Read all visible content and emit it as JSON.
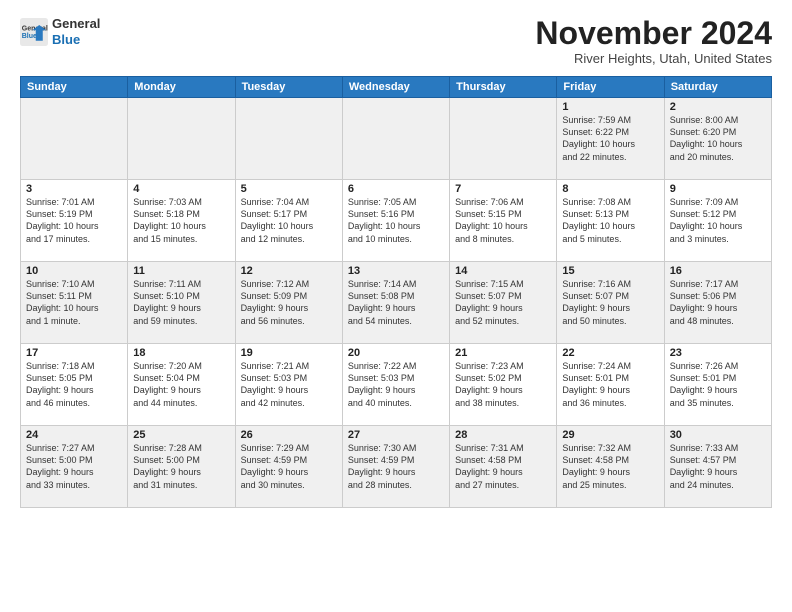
{
  "header": {
    "logo_line1": "General",
    "logo_line2": "Blue",
    "month": "November 2024",
    "location": "River Heights, Utah, United States"
  },
  "days_of_week": [
    "Sunday",
    "Monday",
    "Tuesday",
    "Wednesday",
    "Thursday",
    "Friday",
    "Saturday"
  ],
  "weeks": [
    [
      {
        "day": "",
        "info": ""
      },
      {
        "day": "",
        "info": ""
      },
      {
        "day": "",
        "info": ""
      },
      {
        "day": "",
        "info": ""
      },
      {
        "day": "",
        "info": ""
      },
      {
        "day": "1",
        "info": "Sunrise: 7:59 AM\nSunset: 6:22 PM\nDaylight: 10 hours\nand 22 minutes."
      },
      {
        "day": "2",
        "info": "Sunrise: 8:00 AM\nSunset: 6:20 PM\nDaylight: 10 hours\nand 20 minutes."
      }
    ],
    [
      {
        "day": "3",
        "info": "Sunrise: 7:01 AM\nSunset: 5:19 PM\nDaylight: 10 hours\nand 17 minutes."
      },
      {
        "day": "4",
        "info": "Sunrise: 7:03 AM\nSunset: 5:18 PM\nDaylight: 10 hours\nand 15 minutes."
      },
      {
        "day": "5",
        "info": "Sunrise: 7:04 AM\nSunset: 5:17 PM\nDaylight: 10 hours\nand 12 minutes."
      },
      {
        "day": "6",
        "info": "Sunrise: 7:05 AM\nSunset: 5:16 PM\nDaylight: 10 hours\nand 10 minutes."
      },
      {
        "day": "7",
        "info": "Sunrise: 7:06 AM\nSunset: 5:15 PM\nDaylight: 10 hours\nand 8 minutes."
      },
      {
        "day": "8",
        "info": "Sunrise: 7:08 AM\nSunset: 5:13 PM\nDaylight: 10 hours\nand 5 minutes."
      },
      {
        "day": "9",
        "info": "Sunrise: 7:09 AM\nSunset: 5:12 PM\nDaylight: 10 hours\nand 3 minutes."
      }
    ],
    [
      {
        "day": "10",
        "info": "Sunrise: 7:10 AM\nSunset: 5:11 PM\nDaylight: 10 hours\nand 1 minute."
      },
      {
        "day": "11",
        "info": "Sunrise: 7:11 AM\nSunset: 5:10 PM\nDaylight: 9 hours\nand 59 minutes."
      },
      {
        "day": "12",
        "info": "Sunrise: 7:12 AM\nSunset: 5:09 PM\nDaylight: 9 hours\nand 56 minutes."
      },
      {
        "day": "13",
        "info": "Sunrise: 7:14 AM\nSunset: 5:08 PM\nDaylight: 9 hours\nand 54 minutes."
      },
      {
        "day": "14",
        "info": "Sunrise: 7:15 AM\nSunset: 5:07 PM\nDaylight: 9 hours\nand 52 minutes."
      },
      {
        "day": "15",
        "info": "Sunrise: 7:16 AM\nSunset: 5:07 PM\nDaylight: 9 hours\nand 50 minutes."
      },
      {
        "day": "16",
        "info": "Sunrise: 7:17 AM\nSunset: 5:06 PM\nDaylight: 9 hours\nand 48 minutes."
      }
    ],
    [
      {
        "day": "17",
        "info": "Sunrise: 7:18 AM\nSunset: 5:05 PM\nDaylight: 9 hours\nand 46 minutes."
      },
      {
        "day": "18",
        "info": "Sunrise: 7:20 AM\nSunset: 5:04 PM\nDaylight: 9 hours\nand 44 minutes."
      },
      {
        "day": "19",
        "info": "Sunrise: 7:21 AM\nSunset: 5:03 PM\nDaylight: 9 hours\nand 42 minutes."
      },
      {
        "day": "20",
        "info": "Sunrise: 7:22 AM\nSunset: 5:03 PM\nDaylight: 9 hours\nand 40 minutes."
      },
      {
        "day": "21",
        "info": "Sunrise: 7:23 AM\nSunset: 5:02 PM\nDaylight: 9 hours\nand 38 minutes."
      },
      {
        "day": "22",
        "info": "Sunrise: 7:24 AM\nSunset: 5:01 PM\nDaylight: 9 hours\nand 36 minutes."
      },
      {
        "day": "23",
        "info": "Sunrise: 7:26 AM\nSunset: 5:01 PM\nDaylight: 9 hours\nand 35 minutes."
      }
    ],
    [
      {
        "day": "24",
        "info": "Sunrise: 7:27 AM\nSunset: 5:00 PM\nDaylight: 9 hours\nand 33 minutes."
      },
      {
        "day": "25",
        "info": "Sunrise: 7:28 AM\nSunset: 5:00 PM\nDaylight: 9 hours\nand 31 minutes."
      },
      {
        "day": "26",
        "info": "Sunrise: 7:29 AM\nSunset: 4:59 PM\nDaylight: 9 hours\nand 30 minutes."
      },
      {
        "day": "27",
        "info": "Sunrise: 7:30 AM\nSunset: 4:59 PM\nDaylight: 9 hours\nand 28 minutes."
      },
      {
        "day": "28",
        "info": "Sunrise: 7:31 AM\nSunset: 4:58 PM\nDaylight: 9 hours\nand 27 minutes."
      },
      {
        "day": "29",
        "info": "Sunrise: 7:32 AM\nSunset: 4:58 PM\nDaylight: 9 hours\nand 25 minutes."
      },
      {
        "day": "30",
        "info": "Sunrise: 7:33 AM\nSunset: 4:57 PM\nDaylight: 9 hours\nand 24 minutes."
      }
    ]
  ]
}
